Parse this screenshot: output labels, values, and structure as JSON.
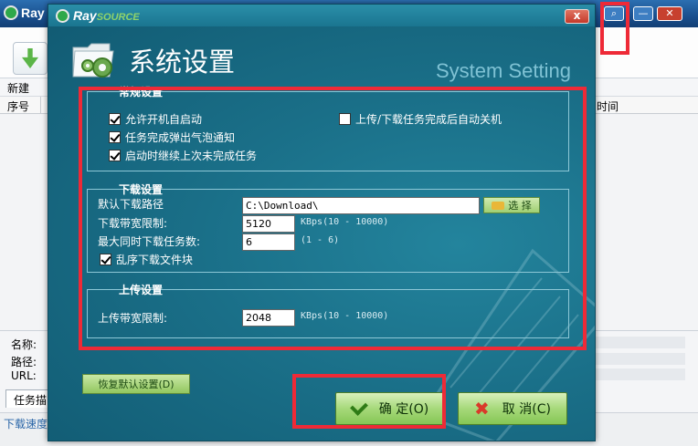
{
  "background_app": {
    "logo_text": "Ray",
    "toolbar": {
      "new_label": "新建"
    },
    "list_columns": [
      "序号",
      "时间"
    ],
    "info_labels": [
      "名称:",
      "路径:",
      "URL:"
    ],
    "tab_label": "任务描",
    "status_text": "下载速度"
  },
  "dialog": {
    "logo": {
      "brand": "Ray",
      "brand_suffix": "SOURCE"
    },
    "close_symbol": "x",
    "title": "系统设置",
    "subtitle": "System Setting",
    "general": {
      "title": "常规设置",
      "options": [
        {
          "label": "允许开机自启动",
          "checked": true
        },
        {
          "label": "任务完成弹出气泡通知",
          "checked": true
        },
        {
          "label": "启动时继续上次未完成任务",
          "checked": true
        },
        {
          "label": "上传/下载任务完成后自动关机",
          "checked": false
        }
      ]
    },
    "download": {
      "title": "下载设置",
      "path_label": "默认下载路径",
      "path_value": "C:\\Download\\",
      "choose_label": "选 择",
      "bandwidth_label": "下载带宽限制:",
      "bandwidth_value": "5120",
      "bandwidth_hint": "KBps(10 - 10000)",
      "max_tasks_label": "最大同时下载任务数:",
      "max_tasks_value": "6",
      "max_tasks_hint": "(1 - 6)",
      "random_blocks_label": "乱序下载文件块",
      "random_blocks_checked": true
    },
    "upload": {
      "title": "上传设置",
      "bandwidth_label": "上传带宽限制:",
      "bandwidth_value": "2048",
      "bandwidth_hint": "KBps(10 - 10000)"
    },
    "buttons": {
      "restore": "恢复默认设置(D)",
      "ok": "确 定(O)",
      "cancel": "取 消(C)"
    }
  },
  "colors": {
    "highlight": "#ee2a37",
    "dialog_bg": "#1a6f88",
    "button_green": "#a6d97a"
  }
}
